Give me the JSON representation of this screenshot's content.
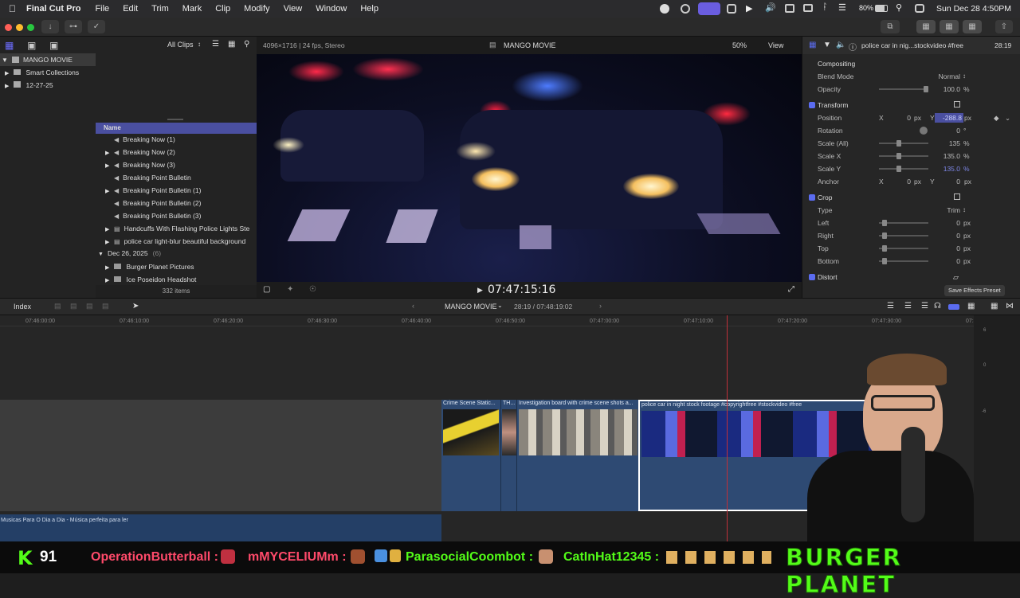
{
  "menubar": {
    "app": "Final Cut Pro",
    "items": [
      "File",
      "Edit",
      "Trim",
      "Mark",
      "Clip",
      "Modify",
      "View",
      "Window",
      "Help"
    ],
    "battery": "80%",
    "clock": "Sun Dec 28  4:50PM"
  },
  "browser": {
    "library": "MANGO MOVIE",
    "library_items": [
      "Smart Collections",
      "12-27-25"
    ],
    "filter": "All Clips",
    "column_header": "Name",
    "items": [
      {
        "name": "Breaking Now (1)",
        "expand": false
      },
      {
        "name": "Breaking Now (2)",
        "expand": true
      },
      {
        "name": "Breaking Now (3)",
        "expand": true
      },
      {
        "name": "Breaking Point Bulletin",
        "expand": false
      },
      {
        "name": "Breaking Point Bulletin (1)",
        "expand": true
      },
      {
        "name": "Breaking Point Bulletin (2)",
        "expand": false
      },
      {
        "name": "Breaking Point Bulletin (3)",
        "expand": false
      },
      {
        "name": "Handcuffs With Flashing Police Lights Ste",
        "expand": true
      },
      {
        "name": "police car light-blur beautiful background",
        "expand": true
      }
    ],
    "date_group": "Dec 26, 2025",
    "date_group_count": "(6)",
    "group_items": [
      "Burger Planet Pictures",
      "Ice Poseidon Headshot"
    ],
    "item_count": "332 items"
  },
  "viewer": {
    "format": "4096×1716 | 24 fps, Stereo",
    "title": "MANGO MOVIE",
    "zoom": "50%",
    "view": "View",
    "timecode": "07:47:15:16"
  },
  "inspector": {
    "clip_name": "police  car in nig...stockvideo #free",
    "duration": "28:19",
    "compositing": "Compositing",
    "blend_mode_label": "Blend Mode",
    "blend_mode": "Normal",
    "opacity_label": "Opacity",
    "opacity": "100.0",
    "transform": "Transform",
    "position_label": "Position",
    "position_x": "0",
    "position_y": "-288.8",
    "rotation_label": "Rotation",
    "rotation": "0",
    "scale_all_label": "Scale (All)",
    "scale_all": "135",
    "scale_x_label": "Scale X",
    "scale_x": "135.0",
    "scale_y_label": "Scale Y",
    "scale_y": "135.0",
    "anchor_label": "Anchor",
    "anchor_x": "0",
    "anchor_y": "0",
    "crop": "Crop",
    "type_label": "Type",
    "type": "Trim",
    "left_label": "Left",
    "right_label": "Right",
    "top_label": "Top",
    "bottom_label": "Bottom",
    "crop_value": "0",
    "distort": "Distort",
    "save_preset": "Save Effects Preset",
    "unit_px": "px",
    "unit_pct": "%",
    "unit_deg": "°",
    "x": "X",
    "y": "Y"
  },
  "timeline": {
    "index": "Index",
    "project": "MANGO MOVIE",
    "position": "28:19 / 07:48:19:02",
    "ticks": [
      "07:46:00:00",
      "07:46:10:00",
      "07:46:20:00",
      "07:46:30:00",
      "07:46:40:00",
      "07:46:50:00",
      "07:47:00:00",
      "07:47:10:00",
      "07:47:20:00",
      "07:47:30:00",
      "07:4"
    ],
    "clips": [
      {
        "label": "Crime Scene Static..."
      },
      {
        "label": "TH..."
      },
      {
        "label": "Investigation board with crime scene shots a..."
      },
      {
        "label": "police  car in night stock footage #copyrightfree #stockvideo #free"
      }
    ],
    "audio_label": "Musicas Para O Dia a Dia - Música perfeita para ler",
    "meter_labels": [
      "6",
      "0",
      "-6"
    ]
  },
  "ticker": {
    "kick_count": "91",
    "users": [
      "OperationButterball :",
      "mMYCELIUMm :",
      "ParasocialCoombot :",
      "CatInHat12345 :"
    ],
    "brand": "BURGER PLANET"
  }
}
